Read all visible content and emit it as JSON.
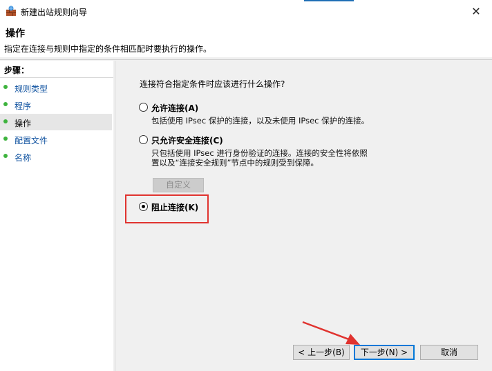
{
  "window": {
    "title": "新建出站规则向导",
    "close_glyph": "✕"
  },
  "header": {
    "title": "操作",
    "description": "指定在连接与规则中指定的条件相匹配时要执行的操作。"
  },
  "steps": {
    "title": "步骤：",
    "items": [
      {
        "label": "规则类型"
      },
      {
        "label": "程序"
      },
      {
        "label": "操作"
      },
      {
        "label": "配置文件"
      },
      {
        "label": "名称"
      }
    ]
  },
  "main": {
    "question": "连接符合指定条件时应该进行什么操作?",
    "options": [
      {
        "label": "允许连接(A)",
        "description": "包括使用 IPsec 保护的连接，以及未使用 IPsec 保护的连接。",
        "selected": false
      },
      {
        "label": "只允许安全连接(C)",
        "description_line1": "只包括使用 IPsec 进行身份验证的连接。连接的安全性将依照",
        "description_line2": "置以及“连接安全规则”节点中的规则受到保障。",
        "selected": false
      },
      {
        "label": "阻止连接(K)",
        "selected": true
      }
    ],
    "custom_button": "自定义"
  },
  "buttons": {
    "back": "< 上一步(B)",
    "next": "下一步(N) >",
    "cancel": "取消"
  },
  "colors": {
    "highlight": "#e0332f",
    "step_dot": "#3db33d",
    "link": "#0b4f9e",
    "default_btn": "#0078d7"
  }
}
